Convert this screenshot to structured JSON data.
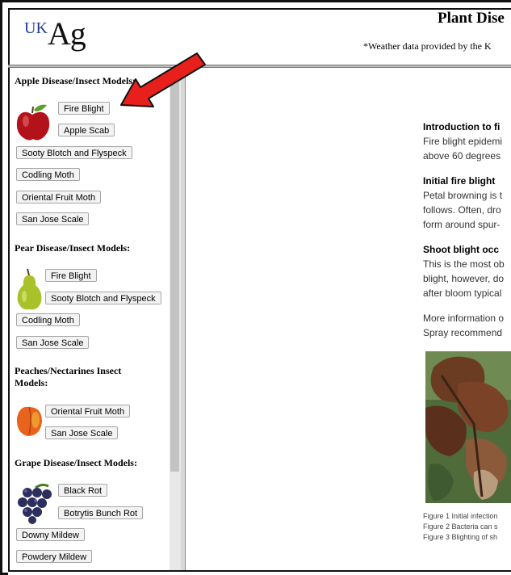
{
  "header": {
    "logo_uk": "UK",
    "logo_ag": "Ag",
    "title": "Plant Dise",
    "weather_note": "*Weather data provided by the K"
  },
  "sidebar": {
    "apple": {
      "title": "Apple Disease/Insect Models:",
      "buttons": [
        "Fire Blight",
        "Apple Scab",
        "Sooty Blotch and Flyspeck",
        "Codling Moth",
        "Oriental Fruit Moth",
        "San Jose Scale"
      ]
    },
    "pear": {
      "title": "Pear Disease/Insect Models:",
      "buttons": [
        "Fire Blight",
        "Sooty Blotch and Flyspeck",
        "Codling Moth",
        "San Jose Scale"
      ]
    },
    "peach": {
      "title_line1": "Peaches/Nectarines Insect",
      "title_line2": "Models:",
      "buttons": [
        "Oriental Fruit Moth",
        "San Jose Scale"
      ]
    },
    "grape": {
      "title": "Grape Disease/Insect Models:",
      "buttons": [
        "Black Rot",
        "Botrytis Bunch Rot",
        "Downy Mildew",
        "Powdery Mildew"
      ]
    }
  },
  "content": {
    "h1": "Introduction to fi",
    "p1": [
      "Fire blight epidemi",
      "above 60 degrees"
    ],
    "h2": "Initial fire blight",
    "p2": [
      "Petal browning is t",
      "follows. Often, dro",
      "form around spur-"
    ],
    "h3": "Shoot blight occ",
    "p3": [
      "This is the most ob",
      "blight, however, do",
      "after bloom typical"
    ],
    "p4": [
      "More information o",
      "Spray recommend"
    ],
    "captions": [
      "Figure 1 Initial infection",
      "Figure 2 Bacteria can s",
      "Figure 3 Blighting of sh"
    ]
  },
  "colors": {
    "annotation_arrow": "#e8201c",
    "logo_uk": "#1f3d8f"
  }
}
